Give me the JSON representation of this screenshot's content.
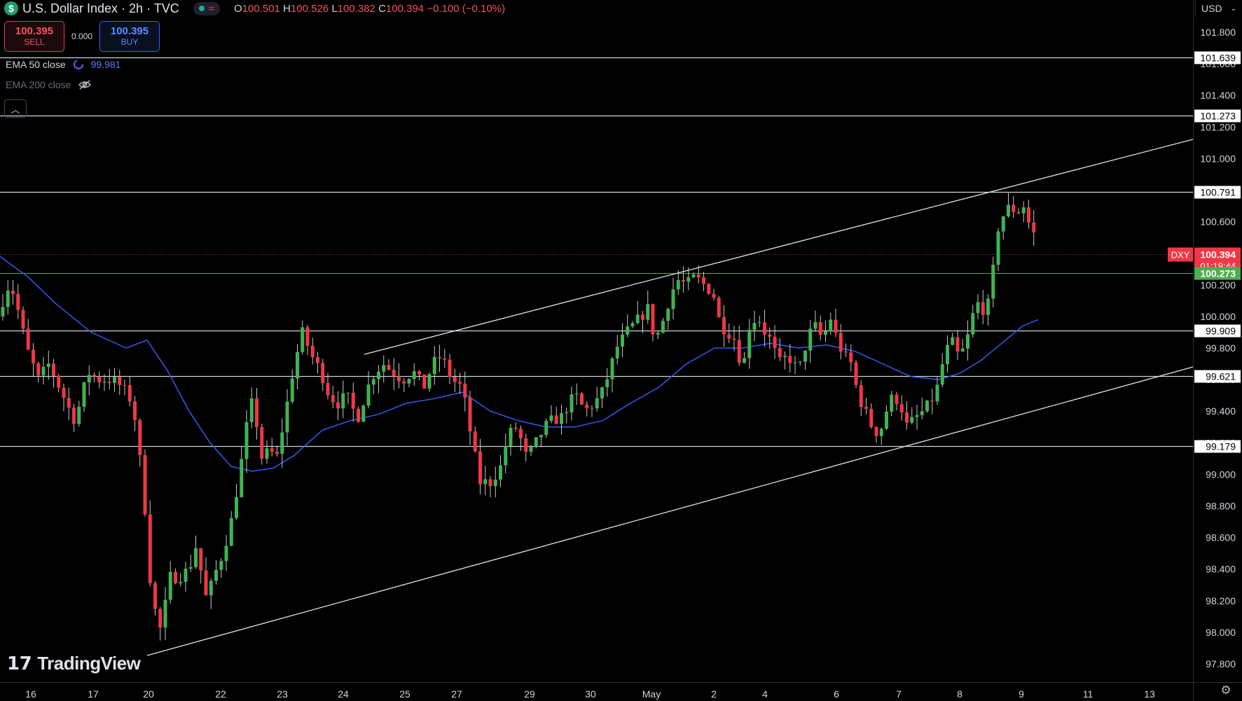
{
  "header": {
    "coin_symbol": "$",
    "title": "U.S. Dollar Index · 2h · TVC",
    "ohlc": [
      {
        "key": "O",
        "value": "100.501"
      },
      {
        "key": "H",
        "value": "100.526"
      },
      {
        "key": "L",
        "value": "100.382"
      },
      {
        "key": "C",
        "value": "100.394"
      }
    ],
    "change": "−0.100 (−0.10%)"
  },
  "trade": {
    "sell_price": "100.395",
    "sell_label": "SELL",
    "spread": "0.000",
    "buy_price": "100.395",
    "buy_label": "BUY"
  },
  "indicators": {
    "ema50_label": "EMA 50 close",
    "ema50_value": "99.981",
    "ema200_label": "EMA 200 close"
  },
  "logo_text": "TradingView",
  "currency_selector": "USD",
  "colors": {
    "up": "#3fb34f",
    "down": "#f23645",
    "ema": "#2f5cf0",
    "support": "#4caf50",
    "background": "#000000",
    "line": "#d1d4dc"
  },
  "chart_data": {
    "type": "candlestick",
    "symbol": "DXY",
    "last_price": "100.394",
    "countdown": "01:19:44",
    "ylim": [
      97.62,
      101.98
    ],
    "yticks": [
      97.8,
      98.0,
      98.2,
      98.4,
      98.6,
      98.8,
      99.0,
      99.2,
      99.4,
      99.6,
      99.8,
      100.0,
      100.2,
      100.4,
      100.6,
      100.8,
      101.0,
      101.2,
      101.4,
      101.6,
      101.8
    ],
    "xticks": [
      "16",
      "17",
      "20",
      "22",
      "23",
      "24",
      "25",
      "27",
      "29",
      "30",
      "May",
      "2",
      "4",
      "6",
      "7",
      "8",
      "9",
      "11",
      "13"
    ],
    "horizontal_levels": [
      101.639,
      101.273,
      100.791,
      99.909,
      99.621,
      99.179
    ],
    "highlight_level": 100.273,
    "trendlines": [
      {
        "from": [
          0,
          97.85
        ],
        "to": [
          1,
          99.71
        ]
      },
      {
        "from": [
          0,
          99.88
        ],
        "to": [
          1,
          101.13
        ]
      }
    ]
  }
}
